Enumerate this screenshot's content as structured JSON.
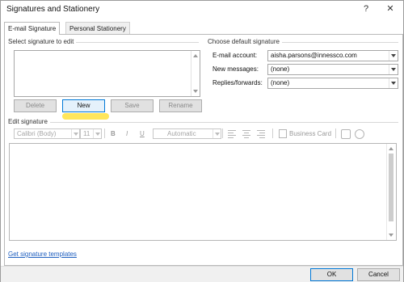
{
  "window": {
    "title": "Signatures and Stationery",
    "help_glyph": "?",
    "close_glyph": "✕"
  },
  "tabs": [
    {
      "label": "E-mail Signature",
      "active": true
    },
    {
      "label": "Personal Stationery",
      "active": false
    }
  ],
  "select_signature": {
    "label": "Select signature to edit",
    "items": []
  },
  "signature_buttons": {
    "delete": "Delete",
    "new": "New",
    "save": "Save",
    "rename": "Rename"
  },
  "defaults": {
    "label": "Choose default signature",
    "email_account_label": "E-mail account:",
    "email_account_value": "aisha.parsons@innessco.com",
    "new_messages_label": "New messages:",
    "new_messages_value": "(none)",
    "replies_label": "Replies/forwards:",
    "replies_value": "(none)"
  },
  "edit": {
    "label": "Edit signature",
    "font_value": "Calibri (Body)",
    "size_value": "11",
    "bold_glyph": "B",
    "italic_glyph": "I",
    "underline_glyph": "U",
    "color_value": "Automatic",
    "business_card": "Business Card",
    "content": ""
  },
  "footer": {
    "link": "Get signature templates",
    "ok": "OK",
    "cancel": "Cancel"
  },
  "colors": {
    "highlight": "#ffe65c",
    "link": "#1f5fbf",
    "focus_border": "#0078d7"
  }
}
